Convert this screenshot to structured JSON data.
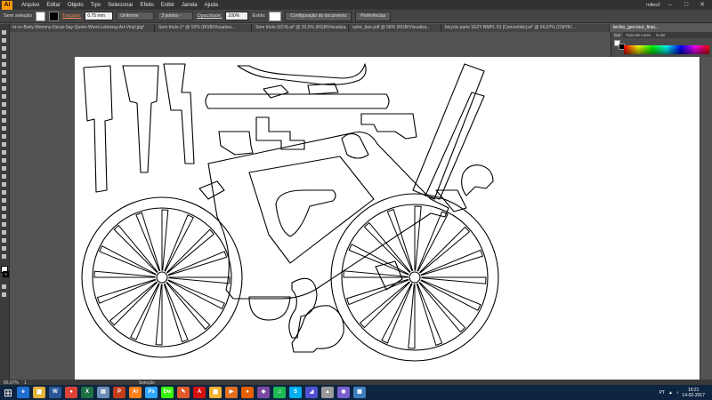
{
  "app": {
    "logo": "Ai",
    "menu": [
      "Arquivo",
      "Editar",
      "Objeto",
      "Tipo",
      "Selecionar",
      "Efeito",
      "Exibir",
      "Janela",
      "Ajuda"
    ],
    "user": "mlles2"
  },
  "controlbar": {
    "selection": "Sem seleção",
    "stroke_label": "Traçado:",
    "stroke_value": "0.75 mm",
    "profile": "Uniforme",
    "brush": "3 pontos -",
    "opacity_label": "Opacidade:",
    "opacity": "100%",
    "style_label": "Estilo:",
    "doc_setup": "Configuração do documento",
    "preferences": "Preferências"
  },
  "tabs": [
    "m-vv-Baby-Mommy-Decal-Say-Quote-Word-Lettering-Art-Vinyl.jpg*",
    "Sem título-1* @ 52% (RGB/Visualiza...",
    "Sem título-2(C4).ai* @ 33,5% (RGB/Visualiza...",
    "oyler_bee.pdf @ 58% (RGB/Visualiza...",
    "bicycle parts 1EZY BMPL 01 [Convertido].ai* @ 66,67% (CMYK/...",
    "teclno_geo-tour_final..."
  ],
  "active_tab": 5,
  "panel": {
    "tabs": [
      "Cor",
      "Guia de cores",
      "Kuler"
    ],
    "active": 0
  },
  "statusbar": {
    "zoom": "66,67%",
    "page": "1",
    "tool": "Seleção"
  },
  "taskbar": {
    "apps": [
      {
        "name": "ie-icon",
        "label": "e",
        "color": "#1e6fd0"
      },
      {
        "name": "explorer-icon",
        "label": "▆",
        "color": "#e1b33b"
      },
      {
        "name": "word-icon",
        "label": "W",
        "color": "#2b5797"
      },
      {
        "name": "chrome-icon",
        "label": "●",
        "color": "#db4437"
      },
      {
        "name": "excel-icon",
        "label": "X",
        "color": "#1e7145"
      },
      {
        "name": "notepad-icon",
        "label": "▤",
        "color": "#6b8db5"
      },
      {
        "name": "ppt-icon",
        "label": "P",
        "color": "#c43e1c"
      },
      {
        "name": "illustrator-icon",
        "label": "Ai",
        "color": "#ff7f18"
      },
      {
        "name": "photoshop-icon",
        "label": "Ps",
        "color": "#31a8ff"
      },
      {
        "name": "dreamweaver-icon",
        "label": "Dw",
        "color": "#35fa00"
      },
      {
        "name": "paint-icon",
        "label": "✎",
        "color": "#e05a2b"
      },
      {
        "name": "pdf-icon",
        "label": "A",
        "color": "#d4130f"
      },
      {
        "name": "folder-icon",
        "label": "▆",
        "color": "#f2b233"
      },
      {
        "name": "media-icon",
        "label": "▶",
        "color": "#e07020"
      },
      {
        "name": "firefox-icon",
        "label": "●",
        "color": "#e66000"
      },
      {
        "name": "app2-icon",
        "label": "◆",
        "color": "#7a4aa3"
      },
      {
        "name": "spotify-icon",
        "label": "♫",
        "color": "#1db954"
      },
      {
        "name": "skype-icon",
        "label": "S",
        "color": "#00aff0"
      },
      {
        "name": "app3-icon",
        "label": "◢",
        "color": "#5050d0"
      },
      {
        "name": "app4-icon",
        "label": "▲",
        "color": "#999"
      },
      {
        "name": "app5-icon",
        "label": "◉",
        "color": "#7a5fd0"
      },
      {
        "name": "app6-icon",
        "label": "▦",
        "color": "#3f7fbf"
      }
    ]
  },
  "tray": {
    "lang": "PT",
    "time": "19:21",
    "date": "14-02-2017"
  }
}
